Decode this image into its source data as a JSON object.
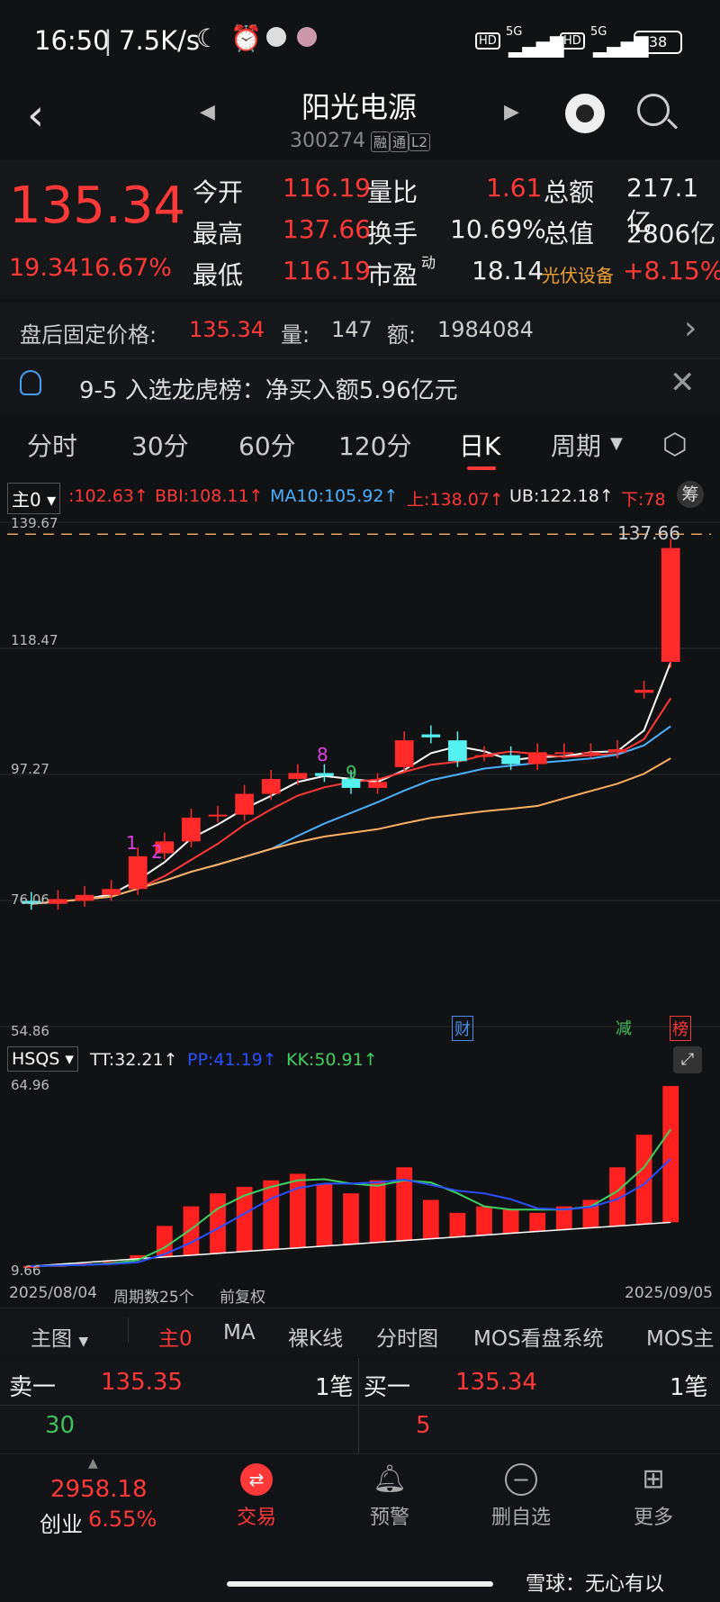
{
  "status": {
    "time": "16:50",
    "speed": "7.5K/s",
    "battery": "38",
    "net1": "5G",
    "net2": "5G",
    "hd": "HD"
  },
  "header": {
    "title": "阳光电源",
    "code": "300274",
    "tag1": "融",
    "tag2": "通",
    "tag3": "L2"
  },
  "quote": {
    "price": "135.34",
    "change": "19.34",
    "change_pct": "16.67%",
    "open_label": "今开",
    "open": "116.19",
    "vr_label": "量比",
    "vr": "1.61",
    "amount_label": "总额",
    "amount": "217.1亿",
    "high_label": "最高",
    "high": "137.66",
    "turnover_label": "换手",
    "turnover": "10.69%",
    "mcap_label": "总值",
    "mcap": "2806亿",
    "low_label": "最低",
    "low": "116.19",
    "pe_label": "市盈",
    "pe_sup": "动",
    "pe": "18.14",
    "sector": "光伏设备",
    "sector_pct": "+8.15%"
  },
  "after_hours": {
    "label": "盘后固定价格:",
    "price": "135.34",
    "vol_label": "量:",
    "vol": "147",
    "amt_label": "额:",
    "amt": "1984084"
  },
  "news": {
    "text": "9-5 入选龙虎榜：净买入额5.96亿元"
  },
  "period_tabs": [
    "分时",
    "30分",
    "60分",
    "120分",
    "日K",
    "周期"
  ],
  "indicators": {
    "main_label": "主0",
    "prefix": ":102.63↑",
    "bbi": "BBI:108.11↑",
    "ma10": "MA10:105.92↑",
    "up": "上:138.07↑",
    "ub": "UB:122.18↑",
    "down": "下:78",
    "chip": "筹"
  },
  "chart": {
    "max_label": "137.66",
    "y_ticks": [
      "139.67",
      "118.47",
      "97.27",
      "76.06",
      "54.86"
    ],
    "markers": [
      "财",
      "减",
      "榜"
    ],
    "nums": [
      "1",
      "2",
      "8",
      "9"
    ]
  },
  "sub_indicator": {
    "name": "HSQS",
    "tt": "TT:32.21↑",
    "pp": "PP:41.19↑",
    "kk": "KK:50.91↑",
    "y_top": "64.96",
    "y_bot": "9.66",
    "s_mark": "S"
  },
  "axis": {
    "start": "2025/08/04",
    "count": "周期数25个",
    "adj": "前复权",
    "end": "2025/09/05"
  },
  "chart_tabs": [
    "主图",
    "主0",
    "MA",
    "裸K线",
    "分时图",
    "MOS看盘系统",
    "MOS主"
  ],
  "orderbook": {
    "sell_label": "卖一",
    "sell_price": "135.35",
    "sell_count": "1笔",
    "sell_vol": "30",
    "buy_label": "买一",
    "buy_price": "135.34",
    "buy_count": "1笔",
    "buy_vol": "5"
  },
  "bottom": {
    "index_value": "2958.18",
    "index_name": "创业",
    "index_pct": "6.55%",
    "nav": [
      "交易",
      "预警",
      "删自选",
      "更多"
    ],
    "watermark": "雪球：无心有以"
  },
  "chart_data": {
    "type": "candlestick",
    "x": [
      "2025/08/04",
      "",
      "",
      "",
      "",
      "",
      "",
      "",
      "",
      "",
      "",
      "",
      "",
      "",
      "",
      "",
      "",
      "",
      "",
      "",
      "",
      "",
      "",
      "",
      "2025/09/05"
    ],
    "open": [
      76.0,
      75.5,
      76.0,
      77.0,
      78.0,
      84.0,
      86.0,
      90.2,
      90.5,
      94.0,
      96.5,
      97.5,
      96.5,
      95.0,
      98.5,
      104.0,
      103.0,
      100.5,
      100.5,
      99.0,
      101.0,
      101.0,
      101.0,
      111.0,
      116.19
    ],
    "close": [
      75.5,
      76.3,
      77.0,
      78.0,
      83.5,
      86.0,
      90.0,
      90.5,
      94.0,
      96.5,
      97.5,
      97.0,
      95.0,
      96.0,
      103.0,
      103.5,
      99.5,
      100.5,
      99.0,
      101.0,
      101.0,
      101.0,
      101.5,
      111.5,
      135.34
    ],
    "ylim": [
      54.86,
      139.67
    ],
    "y_ticks": [
      139.67,
      118.47,
      97.27,
      76.06,
      54.86
    ],
    "volume_hsqs": [
      9.66,
      10.0,
      10.5,
      11.0,
      13.0,
      22.0,
      28.0,
      32.0,
      34.0,
      36.0,
      38.0,
      35.0,
      32.0,
      36.0,
      40.0,
      30.0,
      26.0,
      28.0,
      27.0,
      26.0,
      28.0,
      30.0,
      40.0,
      50.0,
      64.96
    ]
  }
}
